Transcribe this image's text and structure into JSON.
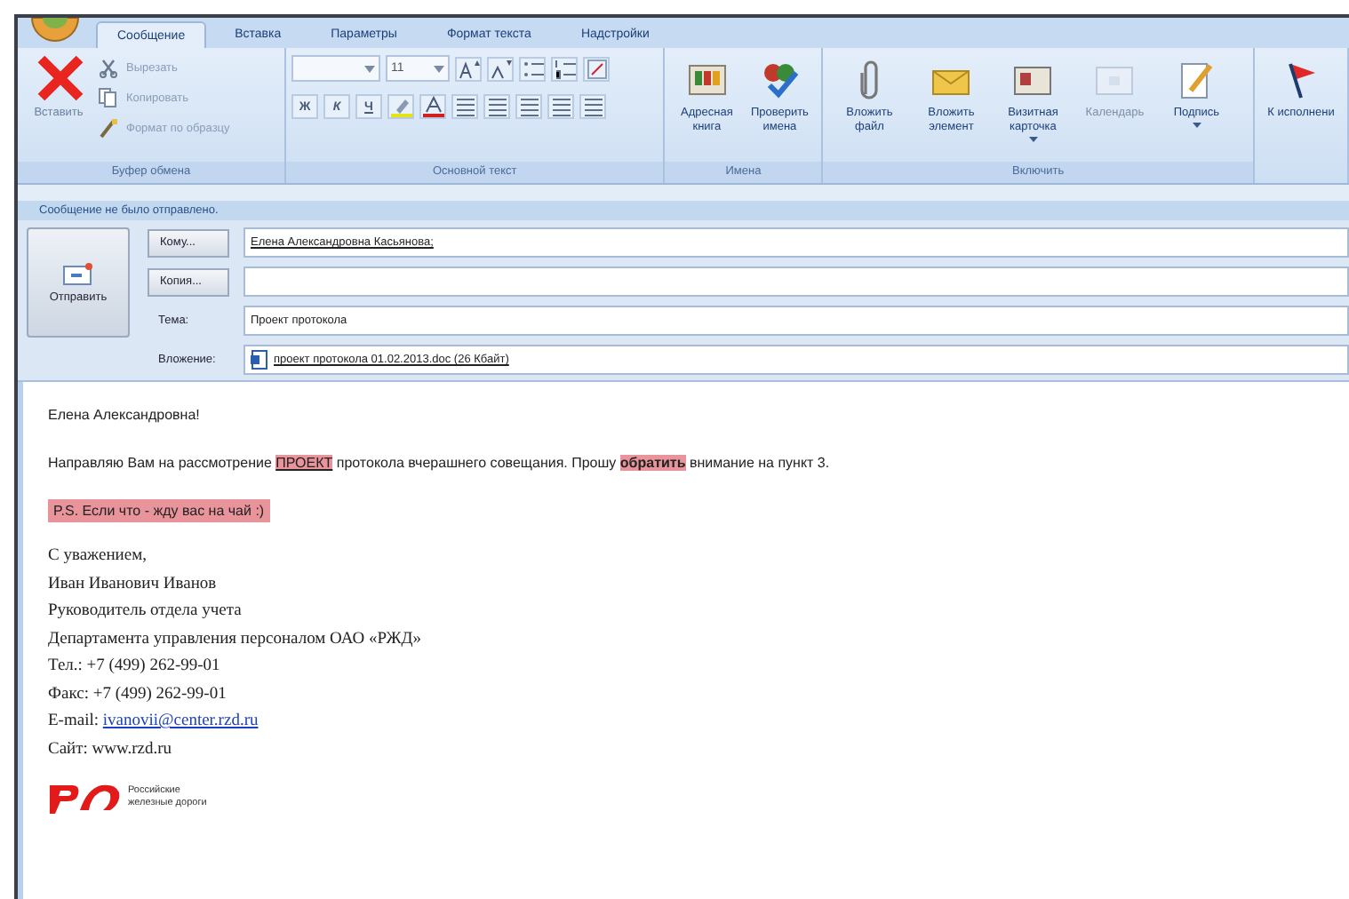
{
  "tabs": [
    {
      "label": "Сообщение",
      "selected": true
    },
    {
      "label": "Вставка",
      "selected": false
    },
    {
      "label": "Параметры",
      "selected": false
    },
    {
      "label": "Формат текста",
      "selected": false
    },
    {
      "label": "Надстройки",
      "selected": false
    }
  ],
  "ribbon": {
    "clipboard": {
      "paste_label": "Вставить",
      "items": [
        "Вырезать",
        "Копировать",
        "Формат по образцу"
      ],
      "group_label": "Буфер обмена"
    },
    "basic_text": {
      "font_size": "11",
      "letters": [
        "Ж",
        "К",
        "Ч"
      ],
      "group_label": "Основной текст"
    },
    "names": {
      "buttons": [
        {
          "label": "Адресная книга",
          "disabled": false,
          "dropdown": false
        },
        {
          "label": "Проверить имена",
          "disabled": false,
          "dropdown": false
        }
      ],
      "group_label": "Имена"
    },
    "include": {
      "buttons": [
        {
          "label": "Вложить файл",
          "disabled": false,
          "dropdown": false
        },
        {
          "label": "Вложить элемент",
          "disabled": false,
          "dropdown": false
        },
        {
          "label": "Визитная карточка",
          "disabled": false,
          "dropdown": true
        },
        {
          "label": "Календарь",
          "disabled": true,
          "dropdown": false
        },
        {
          "label": "Подпись",
          "disabled": false,
          "dropdown": true
        }
      ],
      "group_label": "Включить"
    },
    "followup": {
      "label": "К исполнени"
    }
  },
  "info_bar": "Сообщение не было отправлено.",
  "header": {
    "send": "Отправить",
    "to_button": "Кому...",
    "to_value": "Елена Александровна Касьянова;",
    "cc_button": "Копия...",
    "subject_label": "Тема:",
    "subject": "Проект протокола",
    "attach_label": "Вложение:",
    "attachment": "проект протокола 01.02.2013.doc (26 Кбайт)"
  },
  "body": {
    "greeting": "Елена Александровна!",
    "paragraph": [
      {
        "text": "Направляю Вам на рассмотрение ",
        "highlight": false,
        "bold": false,
        "underline": false
      },
      {
        "text": "ПРОЕКТ",
        "highlight": true,
        "bold": false,
        "underline": true
      },
      {
        "text": " протокола вчерашнего  совещания. Прошу ",
        "highlight": false,
        "bold": false,
        "underline": false
      },
      {
        "text": "обратить",
        "highlight": true,
        "bold": true,
        "underline": false
      },
      {
        "text": " внимание на пункт 3.",
        "highlight": false,
        "bold": false,
        "underline": false
      }
    ],
    "ps": "P.S. Если что - жду вас на чай :)",
    "signature": [
      {
        "text": "С уважением,"
      },
      {
        "text": "Иван Иванович Иванов"
      },
      {
        "text": "Руководитель отдела учета"
      },
      {
        "text": "Департамента управления персоналом ОАО «РЖД»"
      },
      {
        "text": "Тел.: +7 (499) 262-99-01"
      },
      {
        "text": "Факс: +7 (499) 262-99-01"
      },
      {
        "text": "E-mail: ",
        "link": "ivanovii@center.rzd.ru"
      },
      {
        "text": "Сайт: www.rzd.ru"
      }
    ],
    "logo_caption": [
      "Российские",
      "железные дороги"
    ]
  }
}
